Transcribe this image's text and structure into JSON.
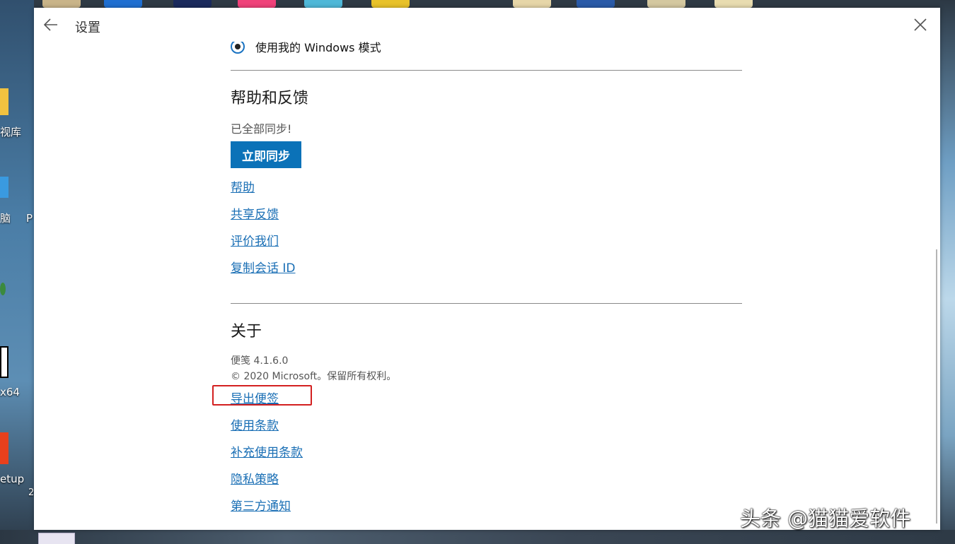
{
  "desktop": {
    "left_labels": [
      "视库",
      "脑",
      "P",
      "x64",
      "etup",
      "2"
    ]
  },
  "window": {
    "title": "设置"
  },
  "settings": {
    "radio_label": "使用我的 Windows 模式",
    "help_section": {
      "title": "帮助和反馈",
      "status": "已全部同步!",
      "sync_button": "立即同步",
      "links": [
        "帮助",
        "共享反馈",
        "评价我们",
        "复制会话 ID"
      ]
    },
    "about_section": {
      "title": "关于",
      "version": "便笺 4.1.6.0",
      "copyright": "© 2020 Microsoft。保留所有权利。",
      "links": [
        "导出便签",
        "使用条款",
        "补充使用条款",
        "隐私策略",
        "第三方通知"
      ]
    }
  },
  "watermark": "头条 @猫猫爱软件"
}
